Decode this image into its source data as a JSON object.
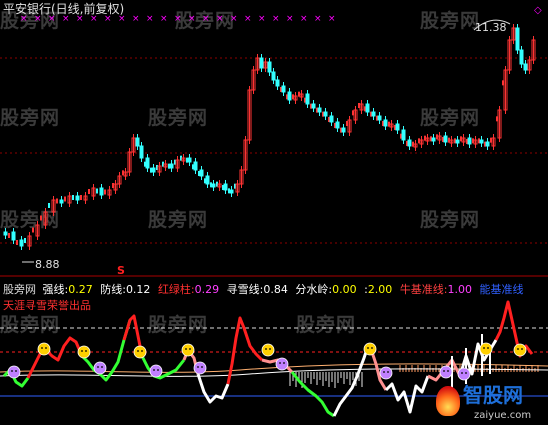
{
  "chart_title": "平安银行(日线,前复权)",
  "price_panel": {
    "high_label": "11.38",
    "low_label": "8.88",
    "s_marker": "S",
    "top_right_marker": "◇"
  },
  "indicator_bar": {
    "site": "股旁网",
    "items": [
      {
        "label": "强线:",
        "value": "0.27",
        "color": "#ffffff",
        "vcolor": "#ffff00"
      },
      {
        "label": "防线:",
        "value": "0.12",
        "color": "#ffffff",
        "vcolor": "#ffffff"
      },
      {
        "label": "红绿柱:",
        "value": "0.29",
        "color": "#ff3030",
        "vcolor": "#ff40ff"
      },
      {
        "label": "寻雪线:",
        "value": "0.84",
        "color": "#ffffff",
        "vcolor": "#ffffff"
      },
      {
        "label": "分水岭:",
        "value": "0.00",
        "color": "#ffffff",
        "vcolor": "#ffff00"
      },
      {
        "label": ":",
        "value": "2.00",
        "color": "#ffffff",
        "vcolor": "#ffff00"
      },
      {
        "label": "牛基准线:",
        "value": "1.00",
        "color": "#ff4040",
        "vcolor": "#ff40ff"
      },
      {
        "label": "能基准线",
        "value": "",
        "color": "#3060ff",
        "vcolor": "#3060ff"
      }
    ],
    "subtitle": "天涯寻雪荣誉出品"
  },
  "watermarks": [
    "股旁网",
    "股旁网",
    "股旁网",
    "股旁网",
    "股旁网",
    "股旁网",
    "股旁网",
    "股旁网",
    "股旁网",
    "股旁网",
    "股旁网",
    "股旁网"
  ],
  "logo": {
    "name": "智股网",
    "url": "zaiyue.com"
  },
  "colors": {
    "up": "#ff3333",
    "down": "#33ffff",
    "grid": "#8b0000",
    "magenta": "#ff00ff"
  }
}
